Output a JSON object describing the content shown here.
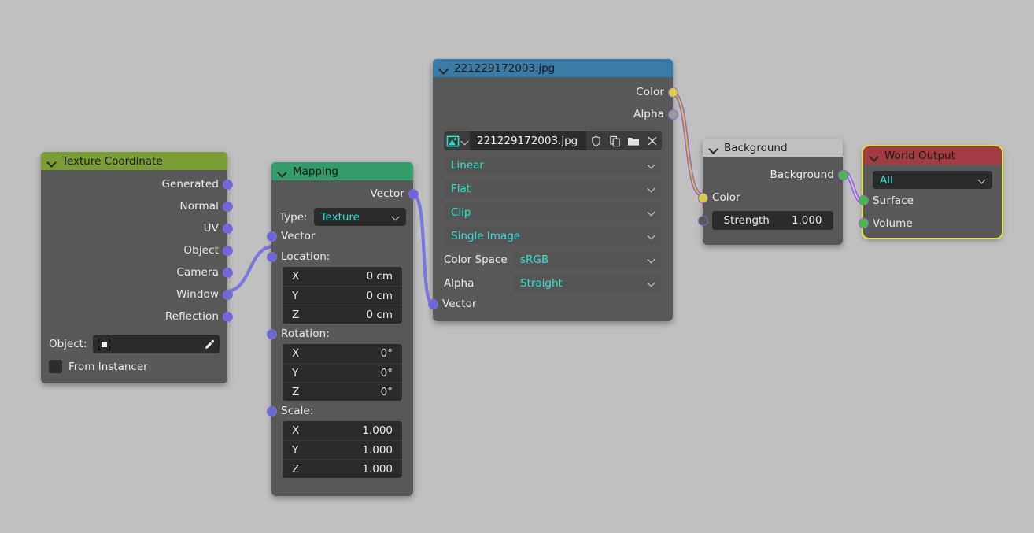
{
  "canvas": {
    "background_color": "#c0c0c0"
  },
  "nodes": {
    "texture_coordinate": {
      "title": "Texture Coordinate",
      "header_color": "#7c9c35",
      "outputs": [
        "Generated",
        "Normal",
        "UV",
        "Object",
        "Camera",
        "Window",
        "Reflection"
      ],
      "object_label": "Object:",
      "object_value": "",
      "object_icon": "object-placeholder-icon",
      "eyedropper_icon": "eyedropper-icon",
      "from_instancer_label": "From Instancer",
      "from_instancer_checked": false
    },
    "mapping": {
      "title": "Mapping",
      "header_color": "#349b6b",
      "output_label": "Vector",
      "type_label": "Type:",
      "type_value": "Texture",
      "input_vector_label": "Vector",
      "location_label": "Location:",
      "location": [
        {
          "axis": "X",
          "value": "0 cm"
        },
        {
          "axis": "Y",
          "value": "0 cm"
        },
        {
          "axis": "Z",
          "value": "0 cm"
        }
      ],
      "rotation_label": "Rotation:",
      "rotation": [
        {
          "axis": "X",
          "value": "0°"
        },
        {
          "axis": "Y",
          "value": "0°"
        },
        {
          "axis": "Z",
          "value": "0°"
        }
      ],
      "scale_label": "Scale:",
      "scale": [
        {
          "axis": "X",
          "value": "1.000"
        },
        {
          "axis": "Y",
          "value": "1.000"
        },
        {
          "axis": "Z",
          "value": "1.000"
        }
      ]
    },
    "image_texture": {
      "title": "221229172003.jpg",
      "header_color": "#3a7ba5",
      "outputs": [
        "Color",
        "Alpha"
      ],
      "datablock": {
        "browse_icon": "image-datablock-icon",
        "name": "221229172003.jpg",
        "fake_user_icon": "shield-icon",
        "duplicate_icon": "copy-icon",
        "open_icon": "folder-icon",
        "unlink_icon": "close-icon"
      },
      "interpolation": "Linear",
      "projection": "Flat",
      "extension": "Clip",
      "source": "Single Image",
      "color_space_label": "Color Space",
      "color_space": "sRGB",
      "alpha_label": "Alpha",
      "alpha_mode": "Straight",
      "input_vector_label": "Vector"
    },
    "background": {
      "title": "Background",
      "header_color": "#c0c0c0",
      "output_label": "Background",
      "color_label": "Color",
      "strength_label": "Strength",
      "strength_value": "1.000"
    },
    "world_output": {
      "title": "World Output",
      "header_color": "#a33c42",
      "active": true,
      "target": "All",
      "inputs": [
        "Surface",
        "Volume"
      ]
    }
  },
  "socket_colors": {
    "vector": "#6a69d8",
    "color": "#d6cf3e",
    "shader": "#4bb84b",
    "gray": "#9a9a9a",
    "outline": "#8f66d8"
  },
  "links": [
    {
      "from": "texture_coordinate.Window",
      "to": "mapping.Vector"
    },
    {
      "from": "mapping.Vector",
      "to": "image_texture.Vector"
    },
    {
      "from": "image_texture.Color",
      "to": "background.Color"
    },
    {
      "from": "background.Background",
      "to": "world_output.Surface"
    }
  ]
}
